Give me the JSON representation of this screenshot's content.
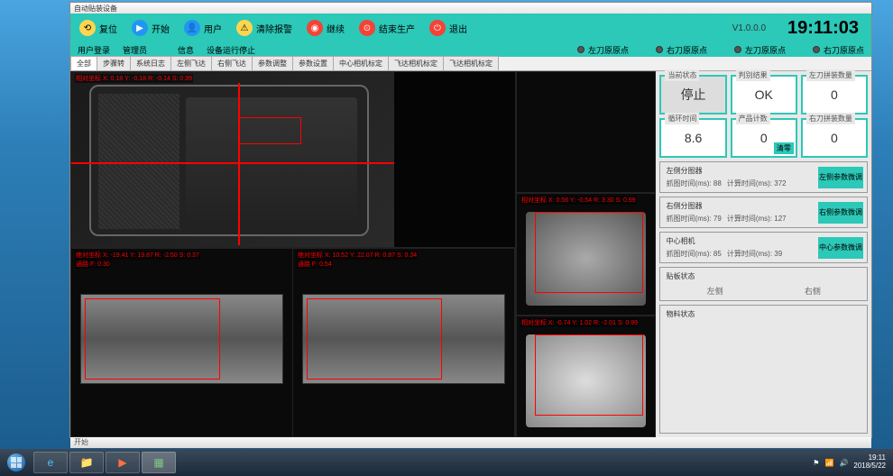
{
  "window": {
    "title": "自动贴装设备"
  },
  "toolbar": {
    "buttons": {
      "reset": "复位",
      "start": "开始",
      "user": "用户",
      "clear_alarm": "清除报警",
      "continue": "继续",
      "end_prod": "结束生产",
      "exit": "退出"
    },
    "version": "V1.0.0.0",
    "clock": "19:11:03"
  },
  "subbar": {
    "items": {
      "user_login": "用户登录",
      "manage": "管理员",
      "info": "信息",
      "status": "设备运行停止"
    },
    "dots": {
      "l_drive": "左刀原原点",
      "r_drive": "右刀原原点",
      "l_motor": "左刀原原点",
      "r_motor": "右刀原原点"
    }
  },
  "tabs": [
    "全部",
    "步骤转",
    "系统日志",
    "左侧飞达",
    "右侧飞达",
    "参数调整",
    "参数设置",
    "中心相机标定",
    "飞达相机标定",
    "飞达相机标定"
  ],
  "coords": {
    "top": "相对坐标 X: 0.18 Y: -0.18 R: -0.14 S: 0.99",
    "bl1": "绝对坐标 X: -19.41 Y: 19.87 R: -2.50 S: 0.37",
    "bl2": "通路 F: 0.30",
    "br1": "绝对坐标 X: 10.52 Y: 22.07 R: 0.87 S: 0.34",
    "br2": "通路 F: 0.54",
    "mid1": "相对坐标 X: 0.56 Y: -0.54 R: 3.30 S: 0.99",
    "mid2": "相对坐标 X: -0.74 Y: 1.02 R: -2.01 S: 0.99"
  },
  "status": {
    "boxes": {
      "current": {
        "label": "当前状态",
        "value": "停止"
      },
      "result": {
        "label": "判别结果",
        "value": "OK"
      },
      "left_count": {
        "label": "左刀拼装数量",
        "value": "0"
      },
      "time": {
        "label": "循环时间",
        "value": "8.6"
      },
      "prod_count": {
        "label": "产品计数",
        "value": "0",
        "clear": "清零"
      },
      "right_count": {
        "label": "右刀拼装数量",
        "value": "0"
      }
    },
    "panels": {
      "left": {
        "title": "左侧分图器",
        "grab": "抓图时间(ms): 88",
        "calc": "计算时间(ms): 372",
        "btn": "左侧参数微调"
      },
      "right": {
        "title": "右侧分图器",
        "grab": "抓图时间(ms): 79",
        "calc": "计算时间(ms): 127",
        "btn": "右侧参数微调"
      },
      "center": {
        "title": "中心相机",
        "grab": "抓图时间(ms): 85",
        "calc": "计算时间(ms): 39",
        "btn": "中心参数微调"
      }
    },
    "knife": {
      "title": "贴板状态",
      "left": "左侧",
      "right": "右侧"
    },
    "material": {
      "title": "物料状态"
    }
  },
  "bottom_status": "开始",
  "taskbar": {
    "time": "19:11",
    "date": "2018/5/22"
  }
}
